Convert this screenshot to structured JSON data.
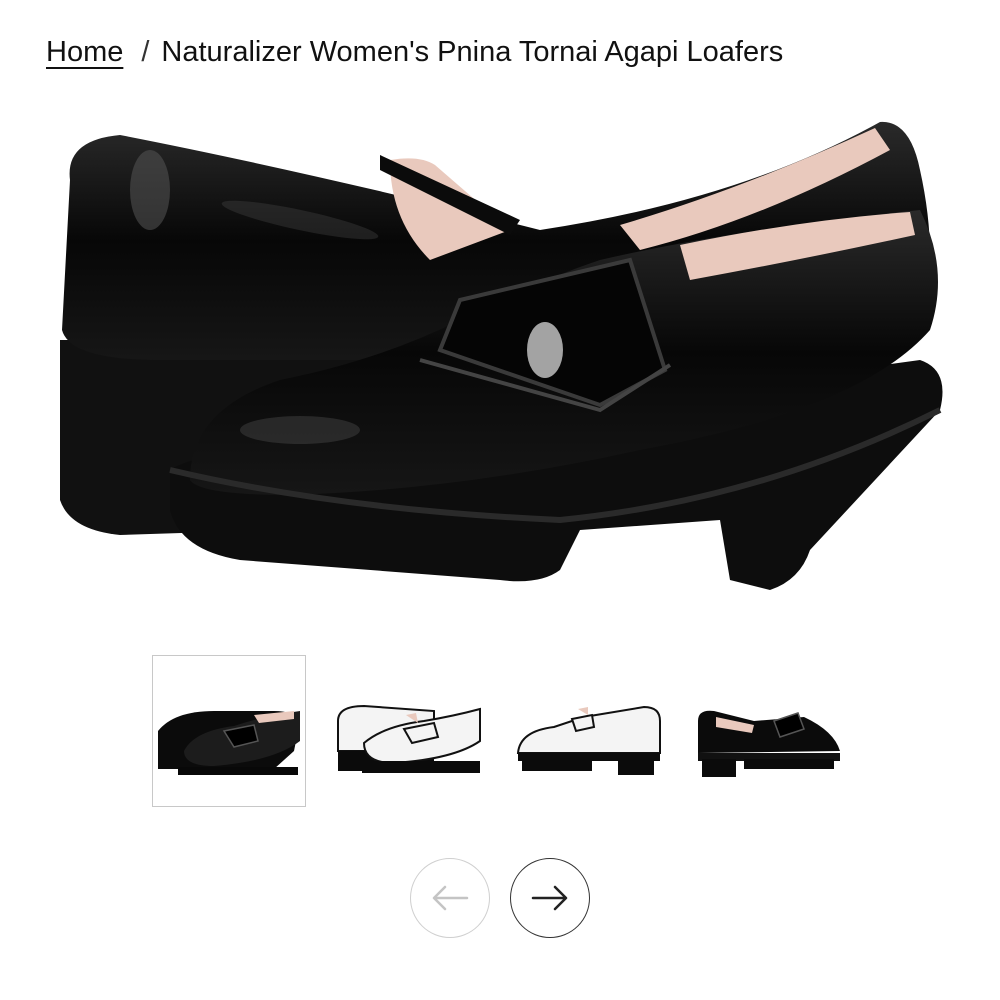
{
  "breadcrumb": {
    "home_label": "Home",
    "separator": "/",
    "current_label": "Naturalizer Women's Pnina Tornai Agapi Loafers"
  },
  "main_image": {
    "alt": "Naturalizer Women's Pnina Tornai Agapi Loafers",
    "colorway": "black-patent"
  },
  "thumbnails": [
    {
      "colorway": "black-patent",
      "selected": true
    },
    {
      "colorway": "white-black-trim",
      "selected": false
    },
    {
      "colorway": "white-black-trim",
      "selected": false
    },
    {
      "colorway": "black-patent",
      "selected": false
    }
  ],
  "carousel": {
    "prev_icon": "arrow-left-icon",
    "next_icon": "arrow-right-icon",
    "prev_disabled": true
  },
  "colors": {
    "text": "#111111",
    "thumb_border": "#c8c8c8",
    "prev_border": "#cfcfcf",
    "next_border": "#333333",
    "patent_black": "#0b0b0b",
    "lining": "#e9c9bd",
    "white_leather": "#f4f4f4"
  }
}
